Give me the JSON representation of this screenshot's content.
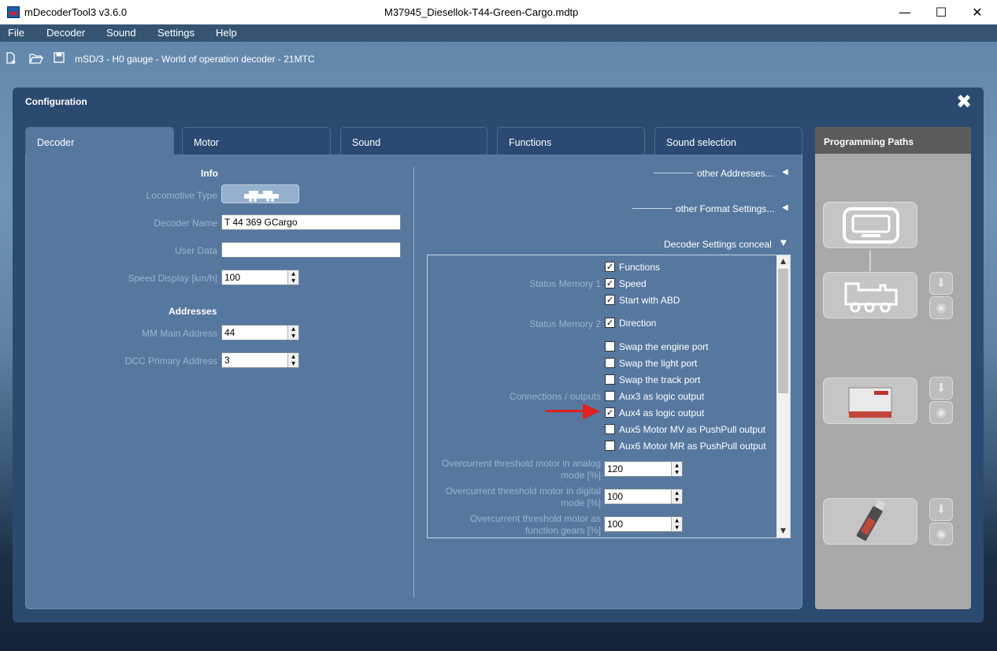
{
  "window": {
    "app_title": "mDecoderTool3  v3.6.0",
    "doc_title": "M37945_Diesellok-T44-Green-Cargo.mdtp",
    "minimize": "—",
    "maximize": "☐",
    "close": "✕"
  },
  "menu": [
    "File",
    "Decoder",
    "Sound",
    "Settings",
    "Help"
  ],
  "toolbar": {
    "new_icon": "new-file-icon",
    "open_icon": "open-folder-icon",
    "save_icon": "save-icon",
    "decoder_path": "mSD/3 - H0 gauge - World of operation decoder - 21MTC"
  },
  "config": {
    "title": "Configuration",
    "close_glyph": "✖",
    "tabs": [
      {
        "label": "Decoder",
        "active": true
      },
      {
        "label": "Motor",
        "active": false
      },
      {
        "label": "Sound",
        "active": false
      },
      {
        "label": "Functions",
        "active": false
      },
      {
        "label": "Sound selection",
        "active": false
      }
    ]
  },
  "info": {
    "header": "Info",
    "locomotive_type_label": "Locomotive Type",
    "decoder_name_label": "Decoder Name",
    "decoder_name_value": "T 44 369 GCargo",
    "user_data_label": "User Data",
    "user_data_value": "",
    "speed_display_label": "Speed Display [km/h]",
    "speed_display_value": "100"
  },
  "addresses": {
    "header": "Addresses",
    "mm_main_label": "MM Main Address",
    "mm_main_value": "44",
    "dcc_primary_label": "DCC Primary Address",
    "dcc_primary_value": "3"
  },
  "right": {
    "other_addresses": "other Addresses...",
    "other_format": "other Format Settings...",
    "decoder_settings": "Decoder Settings conceal"
  },
  "settings": {
    "status_memory_1_label": "Status Memory 1",
    "status_memory_2_label": "Status Memory 2",
    "connections_label": "Connections / outputs",
    "checkboxes": [
      {
        "label": "Functions",
        "checked": true
      },
      {
        "label": "Speed",
        "checked": true
      },
      {
        "label": "Start with ABD",
        "checked": true
      },
      {
        "label": "Direction",
        "checked": true
      },
      {
        "label": "Swap the engine port",
        "checked": false
      },
      {
        "label": "Swap the light port",
        "checked": false
      },
      {
        "label": "Swap the track port",
        "checked": false
      },
      {
        "label": "Aux3 as logic output",
        "checked": false
      },
      {
        "label": "Aux4 as logic output",
        "checked": true
      },
      {
        "label": "Aux5 Motor MV as PushPull output",
        "checked": false
      },
      {
        "label": "Aux6 Motor MR as PushPull output",
        "checked": false
      }
    ],
    "oc_analog_label_1": "Overcurrent threshold motor in analog",
    "oc_analog_label_2": "mode [%]",
    "oc_analog_value": "120",
    "oc_digital_label_1": "Overcurrent threshold motor in digital",
    "oc_digital_label_2": "mode [%]",
    "oc_digital_value": "100",
    "oc_gears_label_1": "Overcurrent threshold motor as",
    "oc_gears_label_2": "function gears [%]",
    "oc_gears_value": "100"
  },
  "programming_paths": {
    "title": "Programming Paths"
  },
  "colors": {
    "accent": "#2b4a6f",
    "panel": "#56789f",
    "annotation_arrow": "#e0211d"
  }
}
